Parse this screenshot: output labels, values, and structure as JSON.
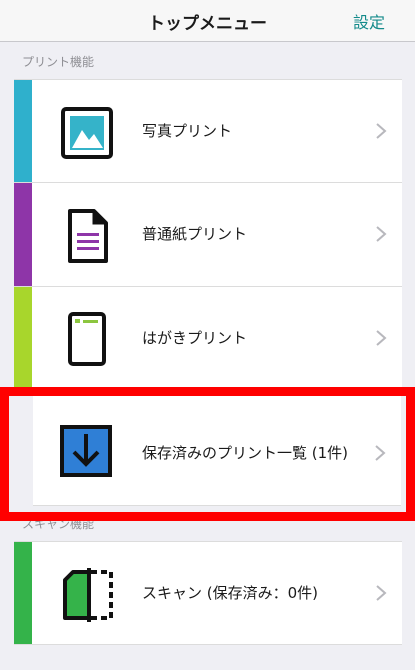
{
  "header": {
    "title": "トップメニュー",
    "settings_label": "設定"
  },
  "sections": {
    "print_label": "プリント機能",
    "scan_label": "スキャン機能"
  },
  "menu": [
    {
      "label": "写真プリント",
      "color": "#2fb0cc",
      "icon": "photo-icon"
    },
    {
      "label": "普通紙プリント",
      "color": "#8e35a8",
      "icon": "document-icon"
    },
    {
      "label": "はがきプリント",
      "color": "#a8d62c",
      "icon": "postcard-icon"
    },
    {
      "label": "保存済みのプリント一覧 (1件)",
      "color": "#ffffff",
      "icon": "download-icon"
    },
    {
      "label": "スキャン (保存済み：0件)",
      "color": "#34b34a",
      "icon": "scan-icon"
    }
  ],
  "highlight": {
    "color": "#ff0000"
  }
}
